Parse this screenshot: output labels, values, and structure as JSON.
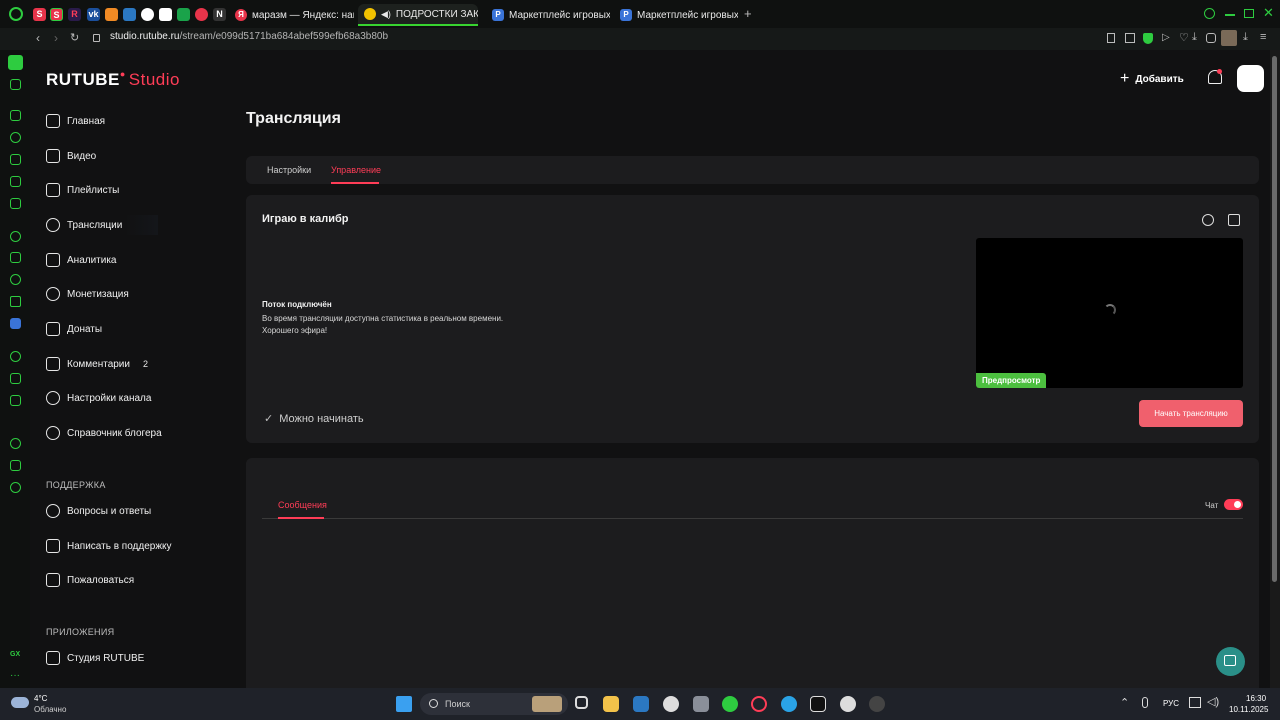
{
  "browser": {
    "tabs": [
      {
        "label": "маразм — Яндекс: нашл",
        "icon": "yandex-icon"
      },
      {
        "label": "ПОДРОСТКИ ЗАКЛА",
        "icon": "sound-icon"
      },
      {
        "label": "Маркетплейс игровых то",
        "icon": "playerok-icon"
      },
      {
        "label": "Маркетплейс игровых то",
        "icon": "playerok-icon"
      }
    ],
    "new_tab": "+",
    "url_host": "studio.rutube.ru",
    "url_path": "/stream/e099d5171ba684abef599efb68a3b80b"
  },
  "app": {
    "logo": "RUTUBE",
    "logo_studio": "Studio",
    "add_label": "Добавить",
    "page_title": "Трансляция",
    "sidebar": {
      "items": [
        {
          "label": "Главная",
          "icon": "home-icon"
        },
        {
          "label": "Видео",
          "icon": "video-icon"
        },
        {
          "label": "Плейлисты",
          "icon": "playlist-icon"
        },
        {
          "label": "Трансляции",
          "icon": "broadcast-icon"
        },
        {
          "label": "Аналитика",
          "icon": "analytics-icon"
        },
        {
          "label": "Монетизация",
          "icon": "ruble-icon"
        },
        {
          "label": "Донаты",
          "icon": "donate-icon"
        },
        {
          "label": "Комментарии",
          "icon": "comment-icon",
          "badge": "2"
        },
        {
          "label": "Настройки канала",
          "icon": "gear-icon"
        },
        {
          "label": "Справочник блогера",
          "icon": "info-icon"
        }
      ],
      "support_heading": "ПОДДЕРЖКА",
      "support": [
        {
          "label": "Вопросы и ответы",
          "icon": "help-icon"
        },
        {
          "label": "Написать в поддержку",
          "icon": "mail-icon"
        },
        {
          "label": "Пожаловаться",
          "icon": "flag-icon"
        }
      ],
      "apps_heading": "ПРИЛОЖЕНИЯ",
      "apps": [
        {
          "label": "Студия RUTUBE",
          "icon": "studio-app-icon"
        }
      ]
    },
    "tabs": [
      "Настройки",
      "Управление"
    ],
    "active_tab": "Управление",
    "stream": {
      "name": "Играю в калибр",
      "status_title": "Поток подключён",
      "status_line1": "Во время трансляции доступна статистика в реальном времени.",
      "status_line2": "Хорошего эфира!",
      "ready": "Можно начинать",
      "preview_badge": "Предпросмотр",
      "start_button": "Начать трансляцию"
    },
    "chat": {
      "tab": "Сообщения",
      "toggle_label": "Чат",
      "toggle_on": true
    }
  },
  "taskbar": {
    "weather_temp": "4°C",
    "weather_cond": "Облачно",
    "search": "Поиск",
    "lang": "РУС",
    "time": "16:30",
    "date": "10.11.2025"
  },
  "colors": {
    "accent": "#ff3d57",
    "button": "#f0606d",
    "preview_badge": "#4cbf3f",
    "opera_green": "#2ecc40"
  }
}
